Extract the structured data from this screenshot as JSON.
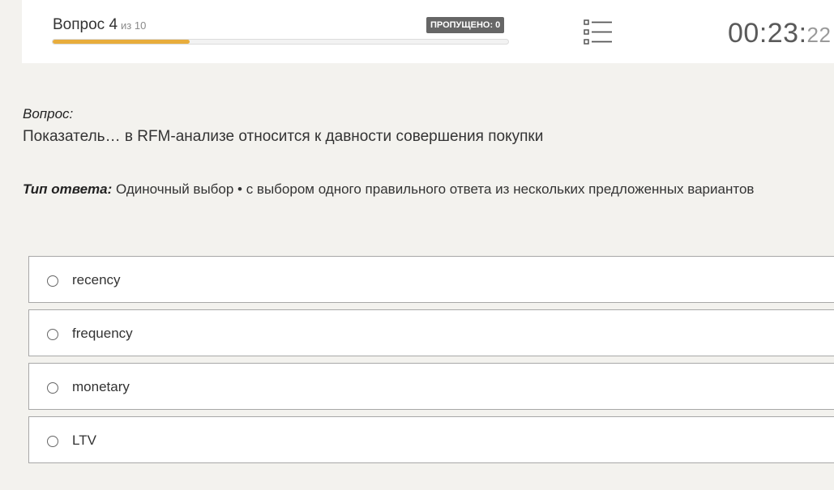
{
  "header": {
    "question_title": "Вопрос 4",
    "question_of": "из 10",
    "skipped_label": "ПРОПУЩЕНО: 0",
    "progress_fraction": 0.3,
    "progress_color": "#e8ad3c",
    "list_icon": "question-list-icon",
    "timer_main": "00:23:",
    "timer_seconds": "22"
  },
  "question": {
    "label": "Вопрос:",
    "text": "Показатель… в RFM-анализе относится к давности совершения покупки"
  },
  "answer_type": {
    "label": "Тип ответа:",
    "value": "Одиночный выбор • с выбором одного правильного ответа из нескольких предложенных вариантов"
  },
  "options": [
    {
      "label": "recency"
    },
    {
      "label": "frequency"
    },
    {
      "label": "monetary"
    },
    {
      "label": "LTV"
    }
  ]
}
